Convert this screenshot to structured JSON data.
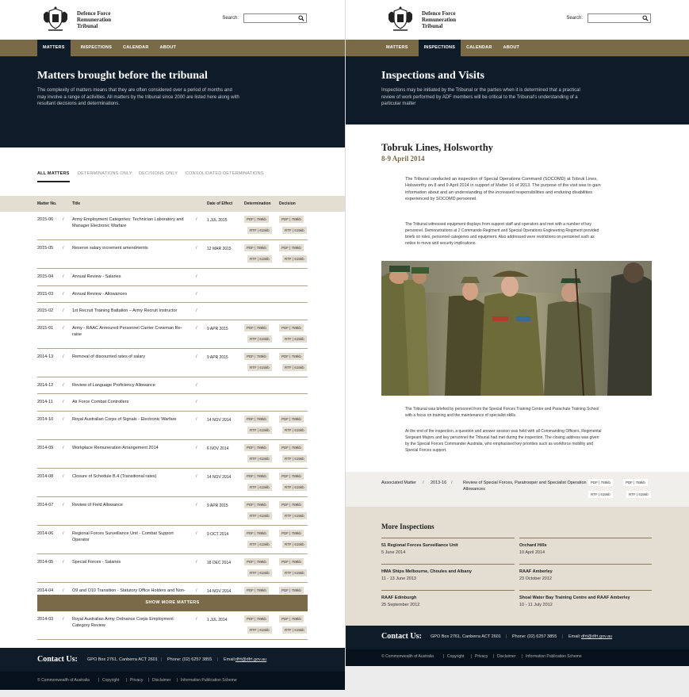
{
  "site": {
    "logo_lines": [
      "Defence Force",
      "Remuneration",
      "Tribunal"
    ],
    "search_label": "Search:",
    "search_value": "",
    "nav": [
      "MATTERS",
      "INSPECTIONS",
      "CALENDAR",
      "ABOUT"
    ]
  },
  "colors": {
    "navy": "#0e1c2a",
    "gold": "#7a6a48",
    "beige": "#e4ddd2"
  },
  "matters_page": {
    "title": "Matters brought before the tribunal",
    "intro": "The complexity of matters means that they are often considered over a period of months and may involve a range of activities. All matters by the tribunal since 2000 are listed here along with resultant decisions and determinations.",
    "filters": [
      "ALL MATTERS",
      "DETERMINATIONS ONLY",
      "DECISIONS ONLY",
      "CONSOLIDATED DETERMINATIONS"
    ],
    "columns": [
      "Matter No.",
      "Title",
      "Date of Effect",
      "Determination",
      "Decision"
    ],
    "pdf_label": "PDF | 789kb",
    "rtf_label": "RTF | 615kb",
    "rows": [
      {
        "no": "2015-06",
        "title": "Army Employment Categories: Technician Laboratory and Manager Electronic Warfare",
        "date": "1 JUL 2015",
        "docs": true
      },
      {
        "no": "2015-05",
        "title": "Reserve salary increment amendments",
        "date": "12 MAR 2015",
        "docs": true
      },
      {
        "no": "2015-04",
        "title": "Annual Review - Salaries",
        "date": "",
        "docs": false
      },
      {
        "no": "2015-03",
        "title": "Annual Review - Allowances",
        "date": "",
        "docs": false
      },
      {
        "no": "2015-02",
        "title": "1st Recruit Training Battalion – Army Recruit Instructor",
        "date": "",
        "docs": false
      },
      {
        "no": "2015-01",
        "title": "Army - RAAC Armoured Personnel Carrier Crewman Re-raise",
        "date": "9 APR 2015",
        "docs": true
      },
      {
        "no": "2014-13",
        "title": "Removal of discounted rates of salary",
        "date": "9 APR 2015",
        "docs": true
      },
      {
        "no": "2014-12",
        "title": "Review of Language Proficiency Allowance",
        "date": "",
        "docs": false
      },
      {
        "no": "2014-11",
        "title": "Air Force Combat Controllers",
        "date": "",
        "docs": false
      },
      {
        "no": "2014-10",
        "title": "Royal Australian Corps of Signals - Electronic Warfare",
        "date": "14 NOV 2014",
        "docs": true
      },
      {
        "no": "2014-09",
        "title": "Workplace Remuneration Arrangement 2014",
        "date": "6 NOV 2014",
        "docs": true
      },
      {
        "no": "2014-08",
        "title": "Closure of Schedule B.4 (Transitional rates)",
        "date": "14 NOV 2014",
        "docs": true
      },
      {
        "no": "2014-07",
        "title": "Review of Field Allowance",
        "date": "9 APR 2015",
        "docs": true
      },
      {
        "no": "2014-06",
        "title": "Regional Forces Surveillance Unit - Combat Support Operator",
        "date": "9 OCT 2014",
        "docs": true
      },
      {
        "no": "2014-05",
        "title": "Special Forces - Salaries",
        "date": "18 DEC 2014",
        "docs": true
      },
      {
        "no": "2014-04",
        "title": "O9 and O10 Transition - Statutory Office Holders and Non-Public Office Holders",
        "date": "14 NOV 2014",
        "docs": true
      },
      {
        "no": "2014-03",
        "title": "Royal Australian Army Ordnance Corps Employment Category Review",
        "date": "1 JUL 2014",
        "docs": true
      }
    ],
    "more_button": "SHOW MORE MATTERS"
  },
  "inspections_page": {
    "title": "Inspections and Visits",
    "intro": "Inspections may be initiated by the Tribunal or the parties when it is determined that a practical review of work performed by ADF members will be critical to the Tribunal's understanding of a particular matter",
    "inspection_title": "Tobruk Lines, Holsworthy",
    "inspection_date": "8-9 April 2014",
    "para1": "The Tribunal conducted an inspection of Special Operations Command (SOCOMD) at Tobruk Lines, Holsworthy on 8 and 9 April 2014 in support of Matter 16 of 2013. The purpose of the visit was to gain information about and an understanding of the increased responsibilities and enduring disabilities experienced by SOCOMD personnel.",
    "para2": "The Tribunal witnessed equipment displays from support staff and operators and met with a number of key personnel. Demonstrations at 2 Commando Regiment and Special Operations Engineering Regiment provided briefs on roles, personnel categories and equipment. Also addressed were restrictions on personnel such as notice to move and security implications.",
    "para3": "The Tribunal was briefed by personnel from the Special Forces Training Centre and Parachute Training School with a focus on training and the maintenance of specialist skills.",
    "para4": "At the end of the inspection, a question and answer session was held with all Commanding Officers, Regimental Sergeant Majors and key personnel the Tribunal had met during the inspection. The closing address was given by the Special Forces Commander Australia, who emphasised key priorities such as workforce mobility and Special Forces support.",
    "assoc_label": "Associated Matter",
    "assoc_no": "2013-16",
    "assoc_title": "Review of Special Forces, Paratrooper and Specialist Operation Allowances",
    "more_title": "More Inspections",
    "more_items": [
      {
        "title": "51 Regional Forces Surveillance Unit",
        "date": "5 June 2014"
      },
      {
        "title": "Orchard Hills",
        "date": "10 April 2014"
      },
      {
        "title": "HMA Ships Melbourne, Choules and Albany",
        "date": "11 - 13 June 2013"
      },
      {
        "title": "RAAF Amberley",
        "date": "23 October 2012"
      },
      {
        "title": "RAAF Edinburgh",
        "date": "25 September 2012"
      },
      {
        "title": "Shoal Water Bay Training Centre and RAAF Amberley",
        "date": "10 - 11 July 2012"
      }
    ]
  },
  "contact": {
    "title": "Contact Us:",
    "address": "GPO Box 2761, Canberra ACT 2601",
    "phone": "Phone: (02) 6257 3855",
    "email_label": "Email:",
    "email": "dfrt@dfrt.gov.au"
  },
  "footer": {
    "items": [
      "© Commonwealth of Australia",
      "Copyright",
      "Privacy",
      "Disclaimer",
      "Information Publication Scheme"
    ]
  }
}
